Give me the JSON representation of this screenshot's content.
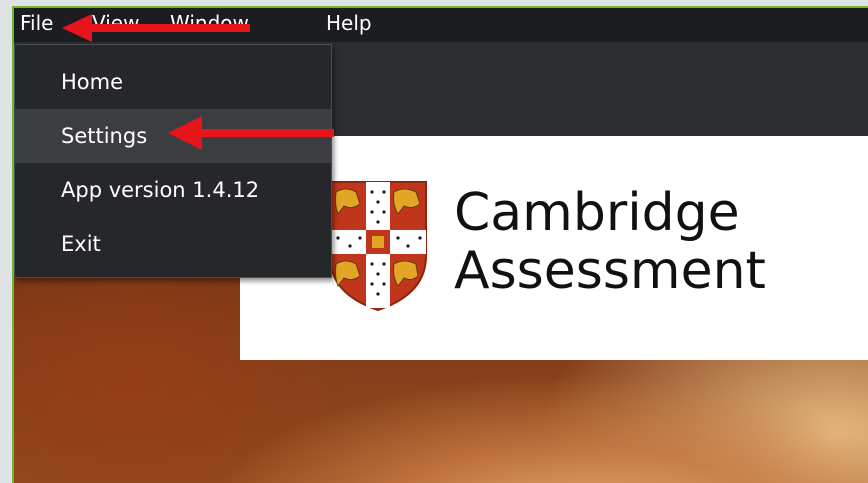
{
  "menubar": {
    "items": [
      {
        "label": "File"
      },
      {
        "label": "View"
      },
      {
        "label": "Window"
      },
      {
        "label": "Help"
      }
    ]
  },
  "file_menu": {
    "items": [
      {
        "label": "Home"
      },
      {
        "label": "Settings",
        "highlighted": true
      },
      {
        "label": "App version 1.4.12"
      },
      {
        "label": "Exit"
      }
    ]
  },
  "banner": {
    "line1": "Cambridge",
    "line2": "Assessment"
  },
  "annotations": {
    "arrow_color": "#e8141b"
  },
  "colors": {
    "window_border": "#6fb82b",
    "menubar_bg": "#1b1d20",
    "menu_bg": "#25272a",
    "menu_highlight": "#3b3d41"
  },
  "icons": {
    "crest": "university-crest-icon"
  }
}
